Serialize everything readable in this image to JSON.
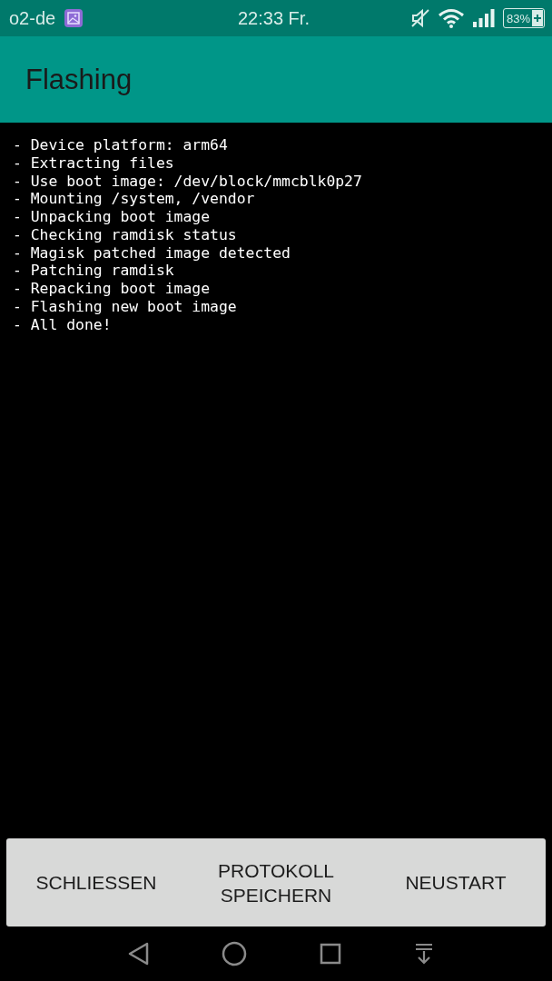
{
  "status_bar": {
    "carrier": "o2-de",
    "time": "22:33 Fr.",
    "battery": "83%"
  },
  "app_bar": {
    "title": "Flashing"
  },
  "log": [
    "- Device platform: arm64",
    "- Extracting files",
    "- Use boot image: /dev/block/mmcblk0p27",
    "- Mounting /system, /vendor",
    "- Unpacking boot image",
    "- Checking ramdisk status",
    "- Magisk patched image detected",
    "- Patching ramdisk",
    "- Repacking boot image",
    "- Flashing new boot image",
    "- All done!"
  ],
  "buttons": [
    "SCHLIESSEN",
    "PROTOKOLL SPEICHERN",
    "NEUSTART"
  ]
}
